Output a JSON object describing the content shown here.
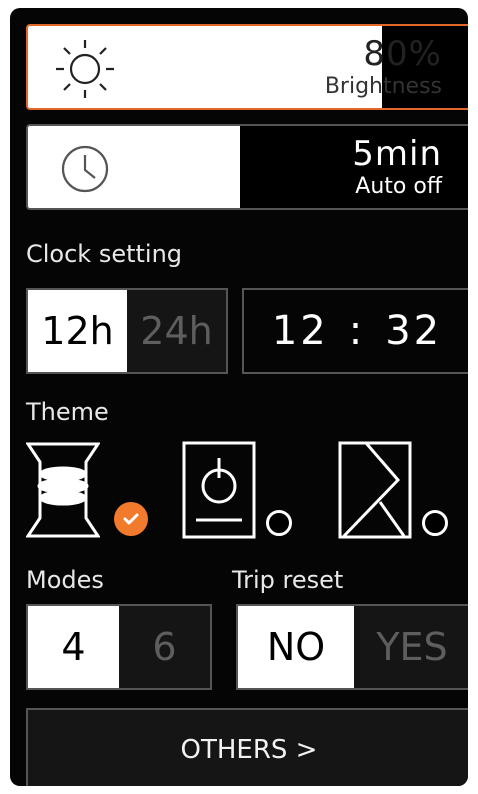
{
  "brightness": {
    "value": "80%",
    "label": "Brightness",
    "level": 0.8,
    "icon": "sun-icon"
  },
  "auto_off": {
    "value": "5min",
    "label": "Auto off",
    "icon": "clock-icon"
  },
  "clock": {
    "label": "Clock setting",
    "options": [
      "12h",
      "24h"
    ],
    "selected": "12h",
    "hours": "12",
    "separator": ":",
    "minutes": "32"
  },
  "theme": {
    "label": "Theme",
    "selected_index": 0,
    "accent": "#f27a2c"
  },
  "modes": {
    "label": "Modes",
    "options": [
      "4",
      "6"
    ],
    "selected": "4"
  },
  "trip_reset": {
    "label": "Trip reset",
    "options": [
      "NO",
      "YES"
    ],
    "selected": "NO"
  },
  "others": {
    "label": "OTHERS >"
  }
}
